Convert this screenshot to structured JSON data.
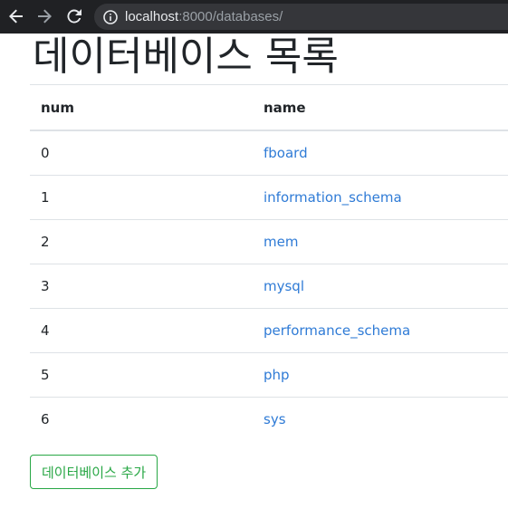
{
  "browser": {
    "url_host": "localhost",
    "url_rest": ":8000/databases/"
  },
  "page": {
    "title": "데이터베이스 목록"
  },
  "table": {
    "headers": [
      "num",
      "name"
    ],
    "rows": [
      {
        "num": "0",
        "name": "fboard"
      },
      {
        "num": "1",
        "name": "information_schema"
      },
      {
        "num": "2",
        "name": "mem"
      },
      {
        "num": "3",
        "name": "mysql"
      },
      {
        "num": "4",
        "name": "performance_schema"
      },
      {
        "num": "5",
        "name": "php"
      },
      {
        "num": "6",
        "name": "sys"
      }
    ]
  },
  "actions": {
    "add_label": "데이터베이스 추가"
  },
  "colors": {
    "link": "#2f7bd6",
    "success": "#28a745",
    "chrome_bg": "#202124"
  },
  "icons": {
    "back": "arrow-left-icon",
    "forward": "arrow-right-icon",
    "reload": "reload-icon",
    "info": "info-icon"
  }
}
